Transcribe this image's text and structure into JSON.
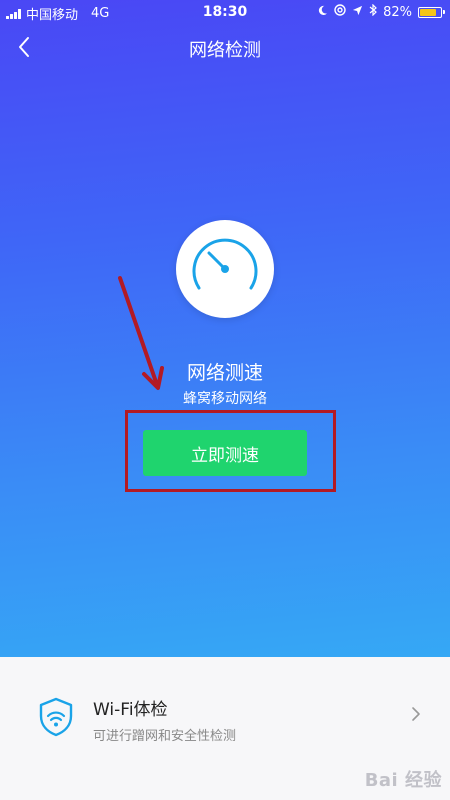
{
  "status_bar": {
    "carrier": "中国移动",
    "network": "4G",
    "time": "18:30",
    "battery": "82%",
    "battery_level": 0.82,
    "icons": [
      "signal-icon",
      "moon-icon",
      "at-icon",
      "location-icon",
      "bluetooth-icon",
      "battery-icon"
    ]
  },
  "nav": {
    "title": "网络检测",
    "back_icon": "chevron-left-icon"
  },
  "speed_test": {
    "icon": "speedometer-icon",
    "title": "网络测速",
    "subtitle": "蜂窝移动网络",
    "button_label": "立即测速"
  },
  "wifi_check": {
    "icon": "wifi-shield-icon",
    "title": "Wi-Fi体检",
    "description": "可进行蹭网和安全性检测",
    "chevron_icon": "chevron-right-icon"
  },
  "watermark": "Bai 经验",
  "colors": {
    "gradient_top": "#4a47f5",
    "gradient_bottom": "#35a8f5",
    "button": "#1fd46e",
    "annotation": "#b31a24",
    "icon_accent": "#1aa3e8"
  }
}
